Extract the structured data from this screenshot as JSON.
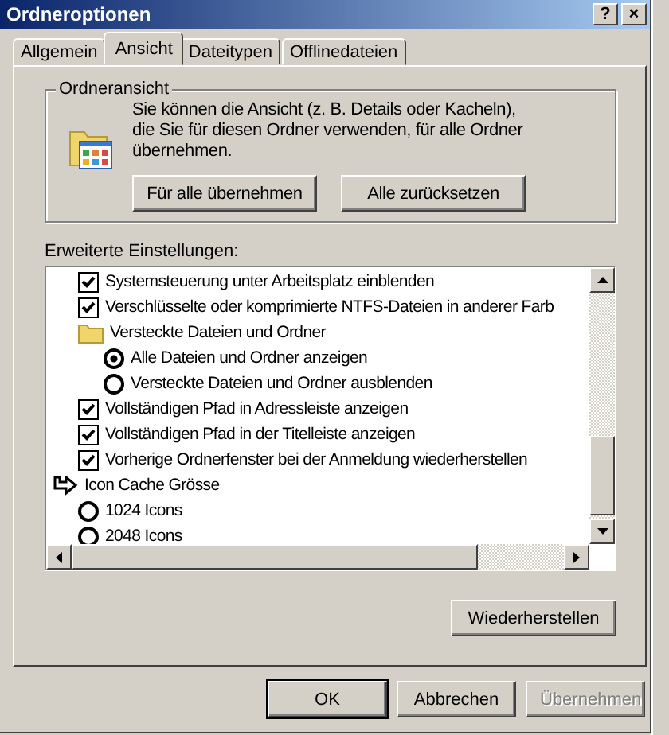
{
  "window": {
    "title": "Ordneroptionen",
    "title_buttons": [
      "?",
      "×"
    ]
  },
  "tabs": [
    {
      "label": "Allgemein",
      "selected": false
    },
    {
      "label": "Ansicht",
      "selected": true
    },
    {
      "label": "Dateitypen",
      "selected": false
    },
    {
      "label": "Offlinedateien",
      "selected": false
    }
  ],
  "folder_view": {
    "title": "Ordneransicht",
    "text": "Sie können die Ansicht (z. B. Details oder Kacheln), die Sie für diesen Ordner verwenden, für alle Ordner übernehmen.",
    "buttons": [
      "Für alle übernehmen",
      "Alle zurücksetzen"
    ]
  },
  "advanced": {
    "label": "Erweiterte Einstellungen:",
    "items": [
      {
        "kind": "checkbox",
        "label": "Systemsteuerung unter Arbeitsplatz einblenden",
        "checked": true
      },
      {
        "kind": "checkbox",
        "label": "Verschlüsselte oder komprimierte NTFS-Dateien in anderer Farb",
        "checked": true
      },
      {
        "kind": "folder",
        "label": "Versteckte Dateien und Ordner",
        "children": [
          {
            "kind": "radio",
            "label": "Alle Dateien und Ordner anzeigen",
            "selected": true
          },
          {
            "kind": "radio",
            "label": "Versteckte Dateien und Ordner ausblenden",
            "selected": false
          }
        ]
      },
      {
        "kind": "checkbox",
        "label": "Vollständigen Pfad in Adressleiste anzeigen",
        "checked": true
      },
      {
        "kind": "checkbox",
        "label": "Vollständigen Pfad in der Titelleiste anzeigen",
        "checked": true
      },
      {
        "kind": "checkbox",
        "label": "Vorherige Ordnerfenster bei der Anmeldung wiederherstellen",
        "checked": true
      },
      {
        "kind": "group",
        "label": "Icon Cache Grösse",
        "children": [
          {
            "kind": "radio",
            "label": "1024 Icons",
            "selected": false
          },
          {
            "kind": "radio",
            "label": "2048 Icons",
            "selected": false
          }
        ]
      }
    ],
    "restore_button": "Wiederherstellen"
  },
  "buttons": [
    {
      "label": "OK",
      "default": true,
      "disabled": false
    },
    {
      "label": "Abbrechen",
      "default": false,
      "disabled": false
    },
    {
      "label": "Übernehmen",
      "default": false,
      "disabled": true
    }
  ]
}
